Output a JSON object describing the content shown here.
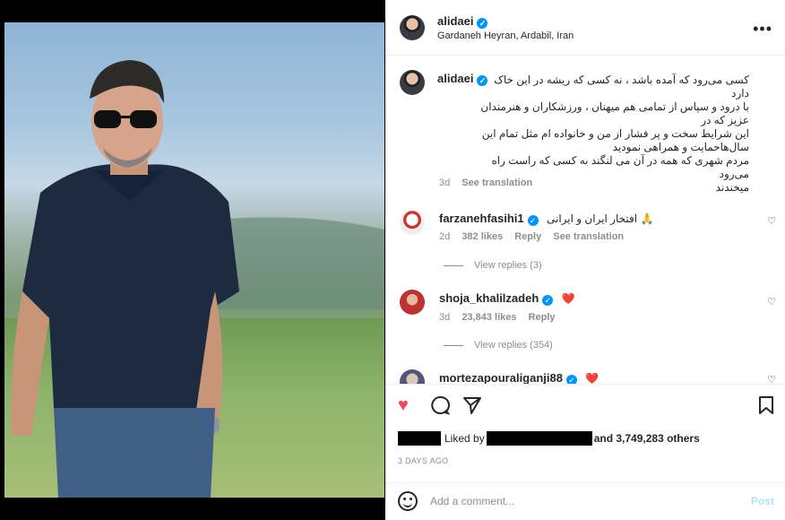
{
  "post": {
    "username": "alidaei",
    "location": "Gardaneh Heyran, Ardabil, Iran",
    "caption_lines": [
      "کسی می‌رود که آمده باشد ، نه کسی که ریشه در این خاک",
      "دارد",
      "با درود و سپاس از تمامی هم میهنان ، ورزشکاران و هنرمندان عزیز که در",
      "این شرایط سخت و پر فشار از من و خانواده ام مثل تمام این",
      "سال‌هاحمایت و همراهی نمودید",
      "مردم شهری که همه در آن می لنگند به کسی که راست راه می‌رود",
      "میخندند"
    ],
    "caption_time": "3d",
    "see_translation": "See translation"
  },
  "comments": [
    {
      "username": "farzanehfasihi1",
      "text": "افتخار ایران و ایرانی 🙏",
      "time": "2d",
      "likes": "382 likes",
      "reply": "Reply",
      "see_translation": "See translation",
      "view_replies": "View replies (3)"
    },
    {
      "username": "shoja_khalilzadeh",
      "text": "❤️",
      "time": "3d",
      "likes": "23,843 likes",
      "reply": "Reply",
      "view_replies": "View replies (354)"
    },
    {
      "username": "mortezapouraliganji88",
      "text": "❤️"
    }
  ],
  "actions": {
    "liked_by": "Liked by",
    "and_others": "and 3,749,283 others",
    "date": "3 DAYS AGO"
  },
  "add_comment": {
    "placeholder": "Add a comment...",
    "post_label": "Post"
  },
  "icons": [
    "heart-icon",
    "comment-icon",
    "share-icon",
    "bookmark-icon",
    "more-icon",
    "emoji-icon",
    "verified-icon"
  ],
  "colors": {
    "like_red": "#ed4956",
    "verified_blue": "#0095f6",
    "post_disabled": "#b2dffc"
  }
}
